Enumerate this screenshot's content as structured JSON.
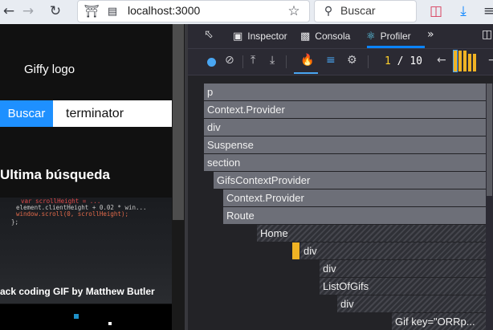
{
  "browser": {
    "url": "localhost:3000",
    "search_placeholder": "Buscar"
  },
  "page": {
    "logo_text": "Giffy logo",
    "search_button": "Buscar",
    "search_value": "terminator",
    "last_search_heading": "Ultima búsqueda",
    "gif_caption": "ack coding GIF by Matthew Butler",
    "gif_code_lines": [
      "var scrollHeight = ...",
      "element.clientHeight + 0.02 * win...",
      "window.scroll(0, scrollHeight);",
      "};"
    ]
  },
  "devtools": {
    "tabs": [
      {
        "label": "Inspector",
        "icon": "inspector-icon"
      },
      {
        "label": "Consola",
        "icon": "console-icon"
      },
      {
        "label": "Profiler",
        "icon": "react-icon"
      }
    ],
    "commit_current": "1",
    "commit_separator": "/",
    "commit_total": "10",
    "accent": "#0a84ff",
    "commit_bar_color": "#f0b324"
  },
  "flamegraph": {
    "nodes": [
      {
        "label": "p",
        "depth": 0,
        "style": "gray"
      },
      {
        "label": "Context.Provider",
        "depth": 1,
        "style": "gray"
      },
      {
        "label": "div",
        "depth": 2,
        "style": "gray"
      },
      {
        "label": "Suspense",
        "depth": 3,
        "style": "gray"
      },
      {
        "label": "section",
        "depth": 4,
        "style": "gray"
      },
      {
        "label": "GifsContextProvider",
        "depth": 5,
        "style": "gray"
      },
      {
        "label": "Context.Provider",
        "depth": 6,
        "style": "gray"
      },
      {
        "label": "Route",
        "depth": 7,
        "style": "gray"
      },
      {
        "label": "Home",
        "depth": 8,
        "style": "hatch"
      },
      {
        "label": "div",
        "depth": 9,
        "style": "hatch"
      },
      {
        "label": "div",
        "depth": 10,
        "style": "hatch"
      },
      {
        "label": "ListOfGifs",
        "depth": 11,
        "style": "hatch"
      },
      {
        "label": "div",
        "depth": 12,
        "style": "hatch"
      },
      {
        "label": "Gif key=\"ORRp...",
        "depth": 13,
        "style": "hatch"
      }
    ]
  }
}
